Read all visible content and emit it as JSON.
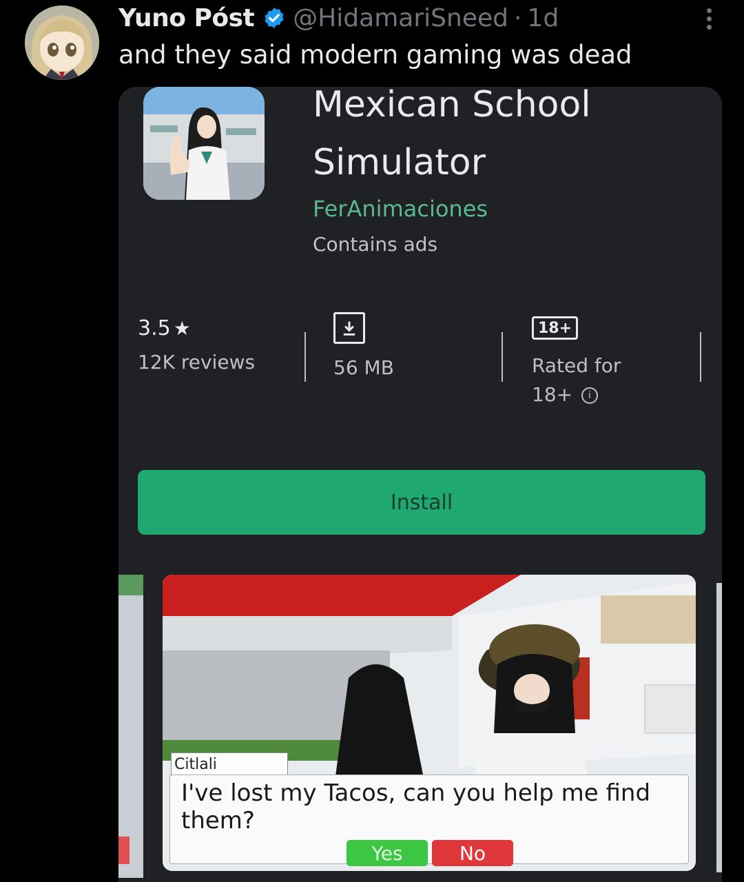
{
  "tweet": {
    "author_name": "Yuno Póst",
    "handle": "@HidamariSneed",
    "separator": "·",
    "age": "1d",
    "text": "and they said modern gaming was dead",
    "colors": {
      "verified": "#1d9bf0",
      "muted": "#71767b"
    }
  },
  "app_listing": {
    "title_line1": "Mexican School",
    "title_line2": "Simulator",
    "developer": "FerAnimaciones",
    "ads_note": "Contains ads",
    "rating": "3.5",
    "rating_icon": "star-icon",
    "reviews": "12K reviews",
    "size": "56 MB",
    "size_icon": "download-icon",
    "age_badge": "18+",
    "age_line1": "Rated for",
    "age_line2": "18+",
    "age_info_icon": "info-icon",
    "install_label": "Install",
    "colors": {
      "install": "#1fa86f",
      "developer": "#5bb990",
      "background": "#202124"
    }
  },
  "game_dialog": {
    "speaker": "Citlali",
    "line": "I've lost my Tacos, can you help me find them?",
    "yes_label": "Yes",
    "no_label": "No",
    "colors": {
      "yes": "#3cc644",
      "no": "#e0383a"
    }
  }
}
